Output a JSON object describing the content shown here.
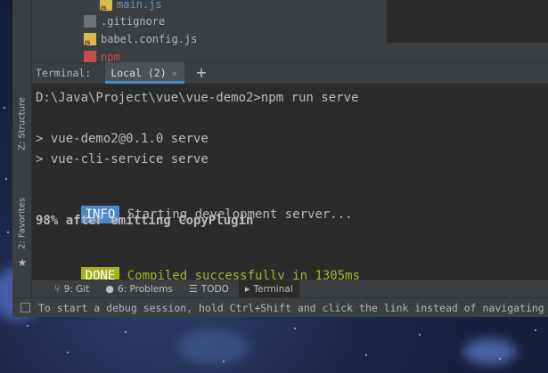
{
  "project_tree": {
    "items": [
      {
        "label": "main.js",
        "type": "js"
      },
      {
        "label": ".gitignore",
        "type": "git"
      },
      {
        "label": "babel.config.js",
        "type": "js"
      },
      {
        "label": "npm",
        "type": "npm"
      }
    ]
  },
  "left_strip": {
    "structure_label": "Z: Structure",
    "favorites_label": "2: Favorites"
  },
  "terminal": {
    "title": "Terminal:",
    "tab_label": "Local (2)",
    "lines": {
      "prompt": "D:\\Java\\Project\\vue\\vue-demo2>npm run serve",
      "script_line1": "> vue-demo2@0.1.0 serve",
      "script_line2": "> vue-cli-service serve",
      "info_badge": "INFO",
      "info_text": "Starting development server...",
      "progress": "98% after emitting CopyPlugin",
      "done_badge": "DONE",
      "done_text": "Compiled successfully in 1305ms"
    }
  },
  "tool_tabs": [
    {
      "label": "9: Git",
      "icon": "git-branch-icon"
    },
    {
      "label": "6: Problems",
      "icon": "problems-icon"
    },
    {
      "label": "TODO",
      "icon": "todo-list-icon"
    },
    {
      "label": "Terminal",
      "icon": "terminal-icon"
    }
  ],
  "status_bar": {
    "message": "To start a debug session, hold Ctrl+Shift and click the link instead of navigating"
  },
  "colors": {
    "info_badge": "#4a88c7",
    "done_badge": "#a4b31e",
    "success_text": "#9fb62d",
    "npm_file": "#c64d4d"
  }
}
